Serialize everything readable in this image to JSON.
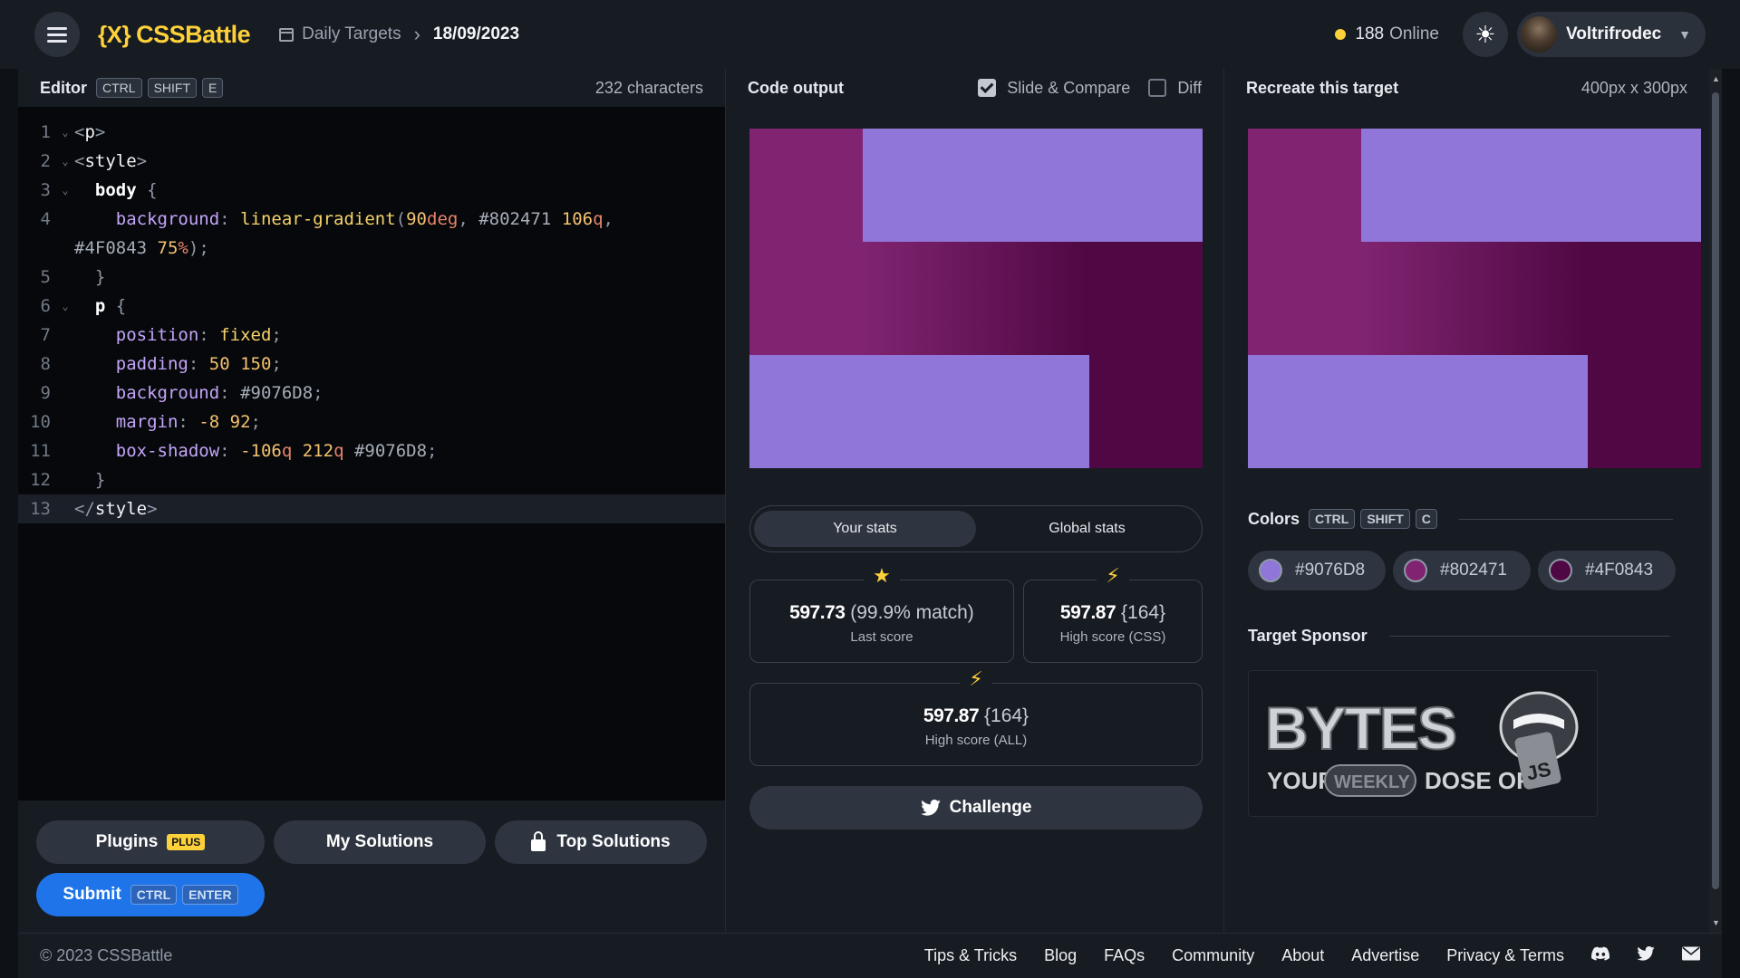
{
  "topbar": {
    "logo": "CSSBattle",
    "logo_mark": "{X}",
    "breadcrumb_section": "Daily Targets",
    "breadcrumb_date": "18/09/2023",
    "online_count": "188",
    "online_label": "Online",
    "username": "Voltrifrodec"
  },
  "editor": {
    "title": "Editor",
    "shortcut": [
      "CTRL",
      "SHIFT",
      "E"
    ],
    "char_count": "232 characters",
    "line_numbers": [
      "1",
      "2",
      "3",
      "4",
      "5",
      "6",
      "7",
      "8",
      "9",
      "10",
      "11",
      "12",
      "13"
    ],
    "code": {
      "l1": "p",
      "l2": "style",
      "l3_sel": "body",
      "l4_prop": "background",
      "l4_fn": "linear-gradient",
      "l4_a": "90",
      "l4_a_unit": "deg",
      "l4_c1": "#802471",
      "l4_s1": "106",
      "l4_s1_unit": "q",
      "l4_c2": "#4F0843",
      "l4_s2": "75",
      "l4_s2_unit": "%",
      "l6_sel": "p",
      "l7_prop": "position",
      "l7_val": "fixed",
      "l8_prop": "padding",
      "l8_val": "50 150",
      "l9_prop": "background",
      "l9_val": "#9076D8",
      "l10_prop": "margin",
      "l10_val": "-8 92",
      "l11_prop": "box-shadow",
      "l11_a": "-106",
      "l11_a_unit": "q",
      "l11_b": "212",
      "l11_b_unit": "q",
      "l11_c": "#9076D8",
      "l13": "style"
    }
  },
  "editor_footer": {
    "plugins": "Plugins",
    "plugins_badge": "PLUS",
    "my_solutions": "My Solutions",
    "top_solutions": "Top Solutions",
    "submit": "Submit",
    "submit_keys": [
      "CTRL",
      "ENTER"
    ]
  },
  "output": {
    "title": "Code output",
    "slide_compare": "Slide & Compare",
    "slide_compare_checked": true,
    "diff": "Diff",
    "diff_checked": false,
    "tabs": [
      "Your stats",
      "Global stats"
    ],
    "active_tab": "Your stats",
    "last_score": "597.73",
    "last_match": "(99.9% match)",
    "last_label": "Last score",
    "high_css": "597.87",
    "high_css_chars": "{164}",
    "high_css_label": "High score (CSS)",
    "high_all": "597.87",
    "high_all_chars": "{164}",
    "high_all_label": "High score (ALL)",
    "challenge": "Challenge"
  },
  "target": {
    "title": "Recreate this target",
    "size": "400px x 300px",
    "colors_label": "Colors",
    "colors_keys": [
      "CTRL",
      "SHIFT",
      "C"
    ],
    "colors": [
      "#9076D8",
      "#802471",
      "#4F0843"
    ],
    "sponsor_label": "Target Sponsor",
    "sponsor_brand": "BYTES",
    "sponsor_tag_your": "YOUR",
    "sponsor_tag_weekly": "WEEKLY",
    "sponsor_tag_dose": "DOSE OF",
    "sponsor_tag_js": "JS"
  },
  "footer": {
    "copyright": "© 2023 CSSBattle",
    "links": [
      "Tips & Tricks",
      "Blog",
      "FAQs",
      "Community",
      "About",
      "Advertise",
      "Privacy & Terms"
    ]
  }
}
